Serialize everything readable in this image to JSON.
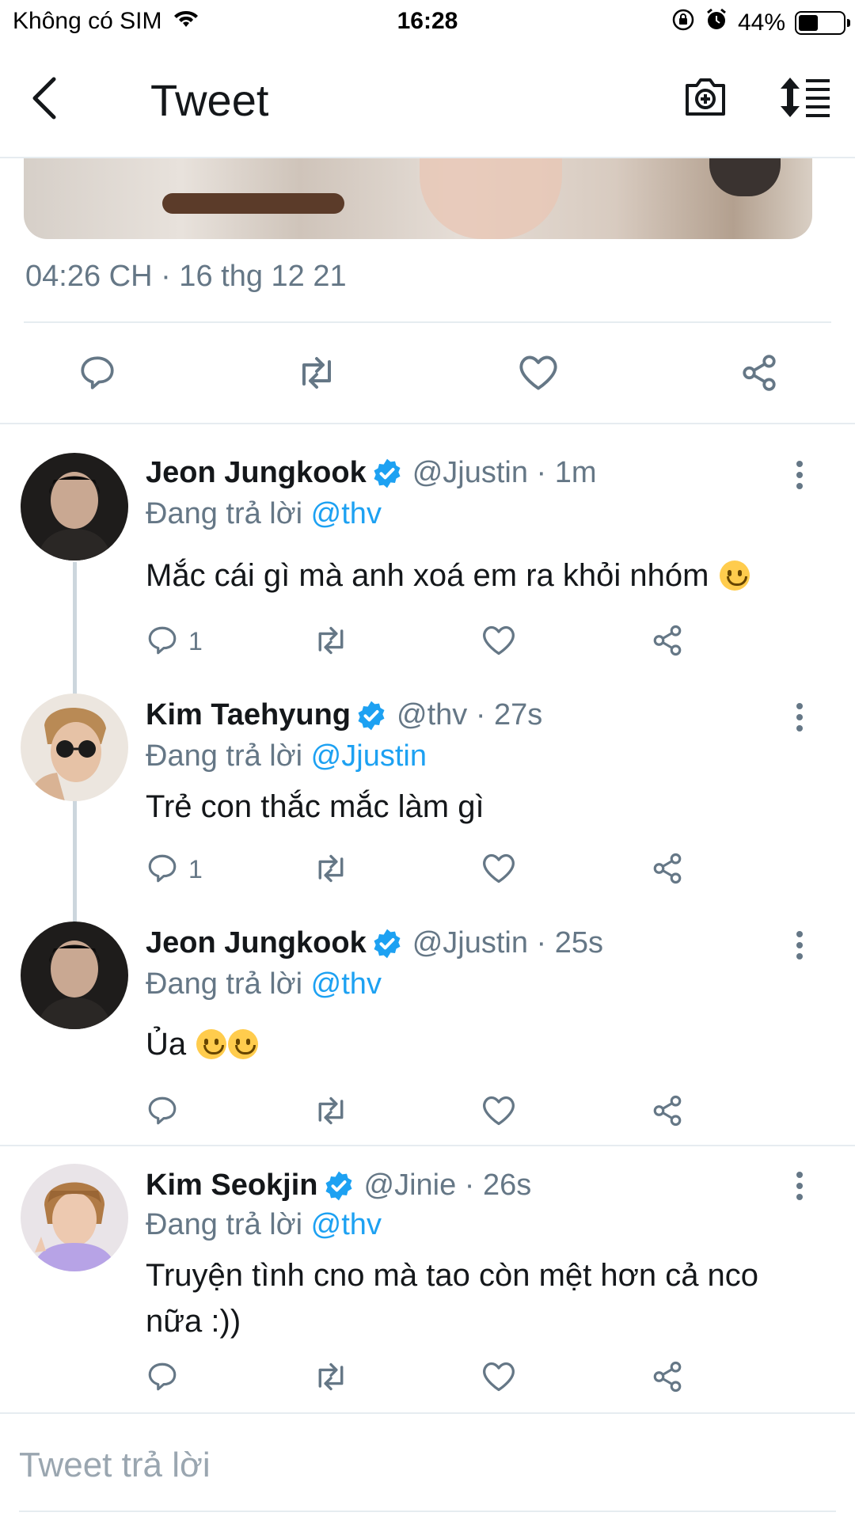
{
  "status_bar": {
    "carrier": "Không có SIM",
    "time": "16:28",
    "battery": "44%",
    "battery_level": 0.44
  },
  "nav": {
    "title": "Tweet",
    "back_icon": "chevron-left-icon",
    "camera_icon": "camera-plus-icon",
    "sort_icon": "sort-icon"
  },
  "tweet": {
    "timestamp": "04:26 CH · 16 thg 12 21"
  },
  "replies": [
    {
      "name": "Jeon Jungkook",
      "handle": "@Jjustin · 1m",
      "replying_prefix": "Đang trả lời",
      "replying_to": "@thv",
      "text": "Mắc cái gì mà anh xoá em ra khỏi nhóm",
      "emoji_count": 1,
      "reply_count": "1",
      "avatar": "dark"
    },
    {
      "name": "Kim Taehyung",
      "handle": "@thv · 27s",
      "replying_prefix": "Đang trả lời",
      "replying_to": "@Jjustin",
      "text": "Trẻ con thắc mắc làm gì",
      "emoji_count": 0,
      "reply_count": "1",
      "avatar": "light"
    },
    {
      "name": "Jeon Jungkook",
      "handle": "@Jjustin · 25s",
      "replying_prefix": "Đang trả lời",
      "replying_to": "@thv",
      "text": "Ủa",
      "emoji_count": 2,
      "reply_count": "",
      "avatar": "dark"
    },
    {
      "name": "Kim Seokjin",
      "handle": "@Jinie · 26s",
      "replying_prefix": "Đang trả lời",
      "replying_to": "@thv",
      "text_line1": "Truyện tình cno mà tao còn mệt hơn cả nco",
      "text_line2": "nữa :))",
      "emoji_count": 0,
      "reply_count": "",
      "avatar": "purple"
    }
  ],
  "compose": {
    "placeholder": "Tweet trả lời"
  },
  "colors": {
    "accent": "#1da1f2",
    "muted": "#657786",
    "divider": "#e6ecf0"
  }
}
